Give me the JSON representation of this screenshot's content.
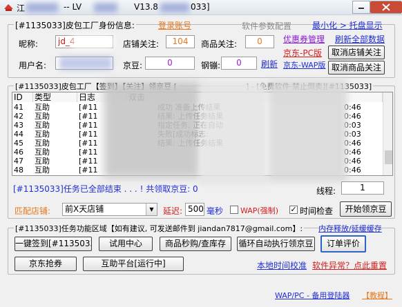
{
  "window": {
    "title_prefix": "江",
    "title_version": "-- LV",
    "title_version_num": "V13.8",
    "title_suffix": "033]",
    "btn_min": "",
    "btn_max": "",
    "btn_close": "✕"
  },
  "topgroup": {
    "title": "[#1135033]皮包工厂身份信息:",
    "login_link": "登录账号",
    "settings_tab": "软件参数配置",
    "minimize_link": "最小化 > 托盘显示",
    "nickname_label": "昵称:",
    "nickname_value": "jd_4",
    "shop_follow_label": "店铺关注:",
    "shop_follow_value": "104",
    "product_follow_label": "商品关注:",
    "product_follow_value": "0",
    "coupon_link": "优惠券管理",
    "refresh_all_link": "刷新全部数据",
    "username_label": "用户名:",
    "username_value": "",
    "jingdou_label": "京豆:",
    "jingdou_value": "0",
    "gangbeng_label": "钢镚:",
    "gangbeng_value": "0",
    "refresh_link": "刷新",
    "jd_pc_link": "京东-PC版",
    "jd_wap_link": "京东-WAP版",
    "cancel_shop_btn": "取消店铺关注",
    "cancel_product_btn": "取消商品关注"
  },
  "taskgroup": {
    "title": "[#1135033]皮包工厂【签到】【关注】领京豆 [",
    "title_right": "] - [免费软件·禁止倒卖][#1135033]",
    "columns": [
      "ID",
      "类型",
      "日志",
      "双击"
    ],
    "rows": [
      {
        "id": "41",
        "type": "互助",
        "log": "[#11",
        "text": "成功  准备上传结果",
        "time": "0:46"
      },
      {
        "id": "42",
        "type": "互助",
        "log": "[#11",
        "text": "结果: 上传任务结果",
        "time": "0:46"
      },
      {
        "id": "43",
        "type": "互助",
        "log": "[#11",
        "text": "指定任务, 正在自动",
        "time": "0:03"
      },
      {
        "id": "44",
        "type": "互助",
        "log": "[#11",
        "text": "失败[成功标志:",
        "time": "0:03"
      },
      {
        "id": "45",
        "type": "互助",
        "log": "[#11",
        "text": "结果: 上传任务结果",
        "time": "0:46"
      },
      {
        "id": "46",
        "type": "互助",
        "log": "[#11",
        "text": "",
        "time": "0:46"
      },
      {
        "id": "47",
        "type": "互助",
        "log": "[#11",
        "text": "",
        "time": "0:46"
      },
      {
        "id": "48",
        "type": "互助",
        "log": "[#11",
        "text": "",
        "time": "0:46"
      }
    ],
    "status_text": "[#1135033]任务已全部结束 . . . ! 共领取京豆: 0",
    "thread_label": "线程:",
    "thread_value": "1",
    "match_shop_label": "匹配店铺:",
    "match_shop_value": "前X天店铺",
    "delay_label": "延迟:",
    "delay_value": "500",
    "delay_unit": "毫秒",
    "wap_checkbox_label": "WAP(强制)",
    "time_check_label": "时间检查",
    "time_check_checked": true,
    "receive_btn": "开始领京豆"
  },
  "funcgroup": {
    "title": "[#1135033]任务功能区域【如有建议, 可发送邮件到 jiandan7817@gmail.com】:",
    "memory_link": "内存释放/延缓缓存",
    "btn_sign": "一键签到[#1135033]",
    "btn_trial": "试用中心",
    "btn_seckill": "商品秒购/查库存",
    "btn_loop": "循环自动执行领京豆",
    "btn_review": "订单评价",
    "btn_jd_grab": "京东抢券",
    "btn_mutual": "互助平台[运行中]",
    "time_sync_link": "本地时间校准",
    "error_link": "软件异常？点此重置"
  },
  "footer": {
    "backup_text": "WAP/PC - 备用登陆器",
    "tutorial_link": "【教程】"
  },
  "colors": {
    "link_blue": "#1f2dd6",
    "link_orange": "#e6761b",
    "link_purple": "#8c1bd6",
    "link_red": "#d61b1b",
    "status_blue": "#1f2dd6"
  }
}
